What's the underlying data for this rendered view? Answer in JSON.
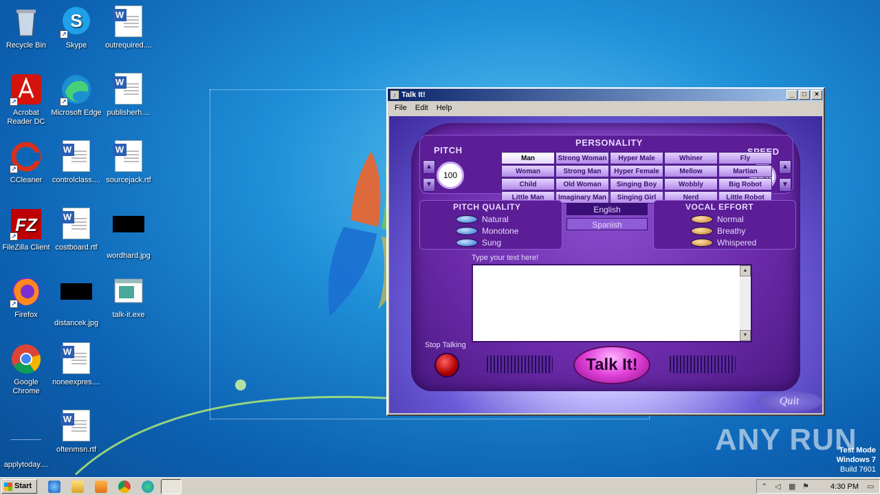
{
  "desktop": {
    "icons": [
      {
        "label": "Recycle Bin"
      },
      {
        "label": "Skype"
      },
      {
        "label": "outrequired...."
      },
      {
        "label": "Acrobat Reader DC"
      },
      {
        "label": "Microsoft Edge"
      },
      {
        "label": "publisherh...."
      },
      {
        "label": "CCleaner"
      },
      {
        "label": "controlclass...."
      },
      {
        "label": "sourcejack.rtf"
      },
      {
        "label": "FileZilla Client"
      },
      {
        "label": "costboard.rtf"
      },
      {
        "label": "wordhard.jpg"
      },
      {
        "label": "Firefox"
      },
      {
        "label": "distancek.jpg"
      },
      {
        "label": "talk-it.exe"
      },
      {
        "label": "Google Chrome"
      },
      {
        "label": "noneexpres...."
      },
      {
        "label": "applytoday...."
      },
      {
        "label": "oftenmsn.rtf"
      }
    ]
  },
  "window": {
    "title": "Talk It!",
    "menu": [
      "File",
      "Edit",
      "Help"
    ]
  },
  "app": {
    "personality_label": "PERSONALITY",
    "pitch_label": "PITCH",
    "speed_label": "SPEED",
    "pitch_value": "100",
    "speed_value": "150",
    "personalities": [
      "Man",
      "Strong Woman",
      "Hyper Male",
      "Whiner",
      "Fly",
      "Woman",
      "Strong Man",
      "Hyper Female",
      "Mellow",
      "Martian",
      "Child",
      "Old Woman",
      "Singing Boy",
      "Wobbly",
      "Big Robot",
      "Little Man",
      "Imaginary Man",
      "Singing Girl",
      "Nerd",
      "Little Robot"
    ],
    "selected_personality": "Man",
    "pitch_quality_label": "PITCH QUALITY",
    "pitch_quality_options": [
      "Natural",
      "Monotone",
      "Sung"
    ],
    "languages": [
      "English",
      "Spanish"
    ],
    "selected_language": "English",
    "vocal_effort_label": "VOCAL EFFORT",
    "vocal_effort_options": [
      "Normal",
      "Breathy",
      "Whispered"
    ],
    "text_prompt": "Type your text here!",
    "text_value": "",
    "stop_label": "Stop Talking",
    "talk_label": "Talk It!",
    "quit_label": "Quit"
  },
  "watermark": {
    "brand": "ANY RUN",
    "line1": "Test Mode",
    "line2": "Windows 7",
    "line3": "Build 7601"
  },
  "taskbar": {
    "start_label": "Start",
    "clock": "4:30 PM"
  }
}
